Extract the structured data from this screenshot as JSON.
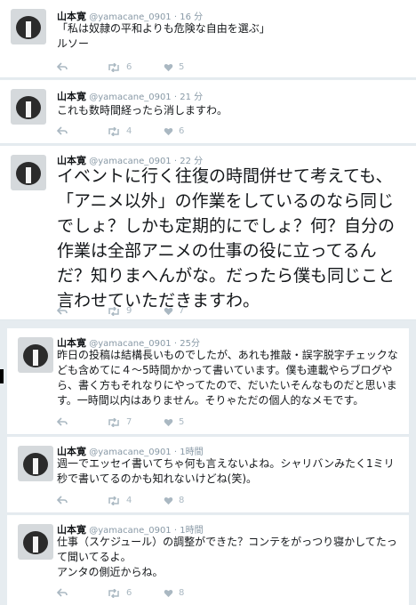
{
  "tweets": [
    {
      "name": "山本寛",
      "handle": "@yamacane_0901",
      "sep": "·",
      "time": "16 分",
      "text": "「私は奴隷の平和よりも危険な自由を選ぶ」\nルソー",
      "retweets": "6",
      "likes": "5"
    },
    {
      "name": "山本寛",
      "handle": "@yamacane_0901",
      "sep": "·",
      "time": "21 分",
      "text": "これも数時間経ったら消しますわ。",
      "retweets": "4",
      "likes": "6"
    },
    {
      "name": "山本寛",
      "handle": "@yamacane_0901",
      "sep": "·",
      "time": "22 分",
      "text": "イベントに行く往復の時間併せて考えても、「アニメ以外」の作業をしているのなら同じでしょ？しかも定期的にでしょ？何？自分の作業は全部アニメの仕事の役に立ってるんだ？知りまへんがな。だったら僕も同じこと言わせていただきますわ。",
      "retweets": "9",
      "likes": "7"
    },
    {
      "name": "山本寛",
      "handle": "@yamacane_0901",
      "sep": "·",
      "time": "25分",
      "text": "昨日の投稿は結構長いものでしたが、あれも推敲・誤字脱字チェックなども含めてに４〜5時間かかって書いています。僕も連載やらブログやら、書く方もそれなりにやってたので、だいたいそんなものだと思います。一時間以内はありません。そりゃただの個人的なメモです。",
      "retweets": "7",
      "likes": "5"
    },
    {
      "name": "山本寛",
      "handle": "@yamacane_0901",
      "sep": "·",
      "time": "1時間",
      "text": "週一でエッセイ書いてちゃ何も言えないよね。シャリバンみたく1ミリ秒で書いてるのかも知れないけどね(笑)。",
      "retweets": "4",
      "likes": "8"
    },
    {
      "name": "山本寛",
      "handle": "@yamacane_0901",
      "sep": "·",
      "time": "1時間",
      "text": "仕事（スケジュール）の調整ができた？コンテをがっつり寝かしてたって聞いてるよ。\nアンタの側近からね。",
      "retweets": "6",
      "likes": "8"
    }
  ],
  "icons": {
    "reply": "reply-arrow-icon",
    "retweet": "retweet-icon",
    "like": "heart-icon"
  }
}
